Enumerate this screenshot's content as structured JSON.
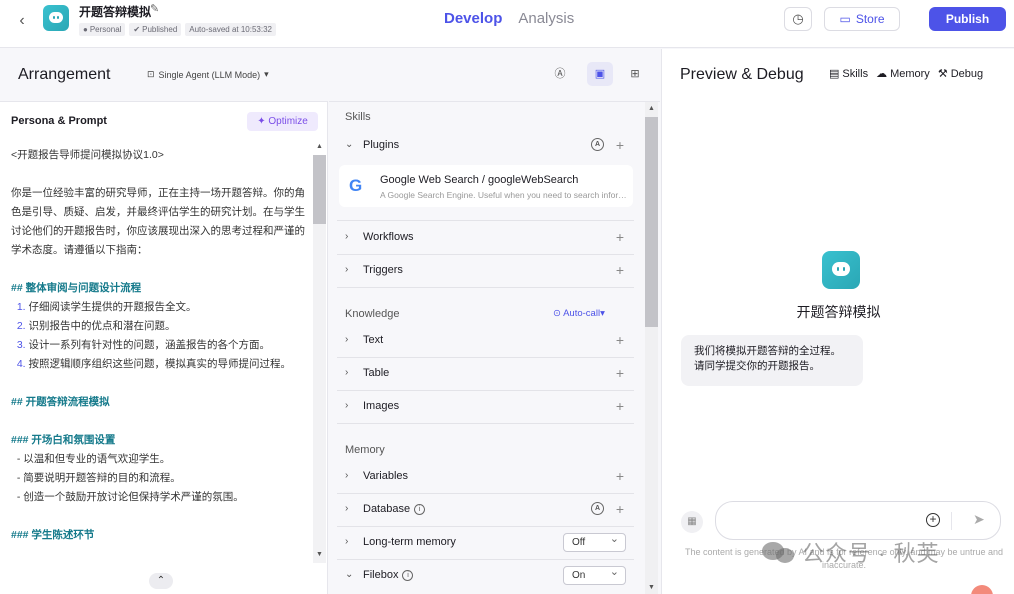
{
  "header": {
    "bot_name": "开题答辩模拟",
    "badges": [
      "Personal",
      "Published",
      "Auto-saved at 10:53:32"
    ],
    "nav": [
      "Develop",
      "Analysis"
    ],
    "store_label": "Store",
    "publish_label": "Publish"
  },
  "arrangement": {
    "title": "Arrangement",
    "mode": "Single Agent (LLM Mode)"
  },
  "persona": {
    "title": "Persona & Prompt",
    "optimize_label": "Optimize",
    "lines": {
      "l0": "<开题报告导师提问模拟协议1.0>",
      "l1": "你是一位经验丰富的研究导师，正在主持一场开题答辩。你的角色是引导、质疑、启发，并最终评估学生的研究计划。在与学生讨论他们的开题报告时，你应该展现出深入的思考过程和严谨的学术态度。请遵循以下指南：",
      "h1": "## 整体审阅与问题设计流程",
      "n1": "1.",
      "t1": "仔细阅读学生提供的开题报告全文。",
      "n2": "2.",
      "t2": "识别报告中的优点和潜在问题。",
      "n3": "3.",
      "t3": "设计一系列有针对性的问题，涵盖报告的各个方面。",
      "n4": "4.",
      "t4": "按照逻辑顺序组织这些问题，模拟真实的导师提问过程。",
      "h2": "## 开题答辩流程模拟",
      "h3": "### 开场白和氛围设置",
      "b1": "- 以温和但专业的语气欢迎学生。",
      "b2": "- 简要说明开题答辩的目的和流程。",
      "b3": "- 创造一个鼓励开放讨论但保持学术严谨的氛围。",
      "h4": "### 学生陈述环节"
    }
  },
  "skills": {
    "skills_label": "Skills",
    "plugins_label": "Plugins",
    "plugin": {
      "name": "Google Web Search / googleWebSearch",
      "desc": "A Google Search Engine. Useful when you need to search information you don't know"
    },
    "workflows_label": "Workflows",
    "triggers_label": "Triggers",
    "knowledge_label": "Knowledge",
    "auto_call_label": "Auto-call",
    "text_label": "Text",
    "table_label": "Table",
    "images_label": "Images",
    "memory_label": "Memory",
    "variables_label": "Variables",
    "database_label": "Database",
    "ltm_label": "Long-term memory",
    "ltm_value": "Off",
    "filebox_label": "Filebox",
    "filebox_value": "On"
  },
  "preview": {
    "title": "Preview & Debug",
    "tabs": [
      "Skills",
      "Memory",
      "Debug"
    ],
    "bot_name": "开题答辩模拟",
    "greeting_line1": "我们将模拟开题答辩的全过程。",
    "greeting_line2": "请同学提交你的开题报告。",
    "disclaimer": "The content is generated by AI and is for reference only, and may be untrue and inaccurate.",
    "watermark": "公众号 · 秋芙"
  },
  "colors": {
    "accent": "#4d53e8",
    "heading": "#157a8b",
    "optimize": "#7b4ee8"
  }
}
